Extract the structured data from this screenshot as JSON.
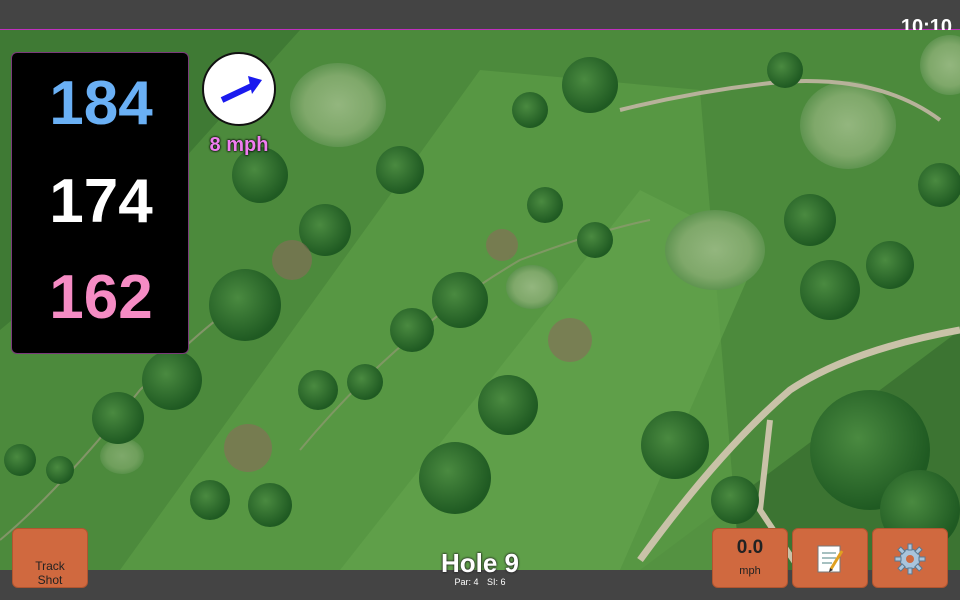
{
  "status": {
    "time": "10:10"
  },
  "distances": {
    "back": "184",
    "center": "174",
    "front": "162"
  },
  "wind": {
    "speed": "8 mph",
    "arrow_icon": "wind-arrow-icon",
    "arrow_color": "#1a1aee"
  },
  "buttons": {
    "track_shot": "Track\nShot",
    "speed_value": "0.0",
    "speed_unit": "mph",
    "notes_icon": "notepad-icon",
    "settings_icon": "gear-icon"
  },
  "hole": {
    "title": "Hole 9",
    "par": "Par: 4",
    "si": "SI: 6"
  },
  "colors": {
    "back": "#6ab0f5",
    "center": "#ffffff",
    "front": "#f58cc4",
    "button": "#d0693f",
    "wind_text": "#f07ef0"
  }
}
